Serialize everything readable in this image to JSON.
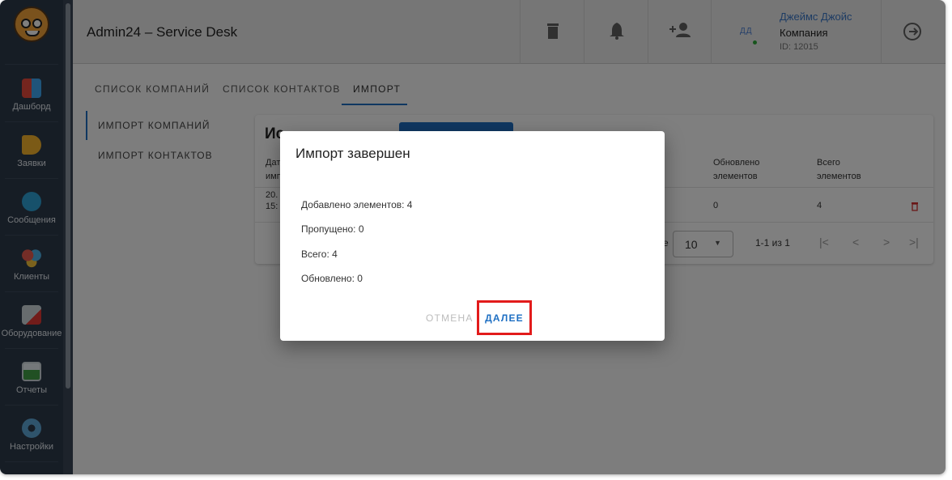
{
  "app": {
    "title": "Admin24 – Service Desk"
  },
  "sidebar": {
    "items": [
      {
        "label": "Дашборд",
        "icon": "dashboard-icon"
      },
      {
        "label": "Заявки",
        "icon": "megaphone-icon"
      },
      {
        "label": "Сообщения",
        "icon": "chat-icon"
      },
      {
        "label": "Клиенты",
        "icon": "people-icon"
      },
      {
        "label": "Оборудование",
        "icon": "equipment-icon"
      },
      {
        "label": "Отчеты",
        "icon": "report-icon"
      },
      {
        "label": "Настройки",
        "icon": "settings-gear-icon"
      }
    ]
  },
  "header": {
    "icons": [
      "trash-icon",
      "bell-icon",
      "add-person-icon",
      "logout-icon"
    ],
    "user": {
      "initials": "ДД",
      "name": "Джеймс Джойс",
      "company": "Компания",
      "id": "ID: 12015"
    }
  },
  "tabs": [
    "СПИСОК КОМПАНИЙ",
    "СПИСОК КОНТАКТОВ",
    "ИМПОРТ"
  ],
  "subnav": [
    "ИМПОРТ КОМПАНИЙ",
    "ИМПОРТ КОНТАКТОВ"
  ],
  "card": {
    "title_fragment": "Ис",
    "col_date_fragment": [
      "Дат",
      "имп"
    ],
    "col_updated": [
      "Обновлено",
      "элементов"
    ],
    "col_total": [
      "Всего",
      "элементов"
    ],
    "row": {
      "date_fragment": [
        "20.",
        "15:"
      ],
      "updated": "0",
      "total": "4"
    },
    "per_page_label_fragment": "е",
    "per_page": "10",
    "page_range": "1-1 из 1"
  },
  "dialog": {
    "title": "Импорт завершен",
    "lines": [
      "Добавлено элементов: 4",
      "Пропущено: 0",
      "Всего: 4",
      "Обновлено: 0"
    ],
    "cancel_label": "ОТМЕНА",
    "next_label": "ДАЛЕЕ"
  },
  "colors": {
    "accent": "#1e6fc3",
    "sidebar": "#2d3a4b",
    "highlight": "#e21b1b",
    "delete": "#d32f2f"
  }
}
